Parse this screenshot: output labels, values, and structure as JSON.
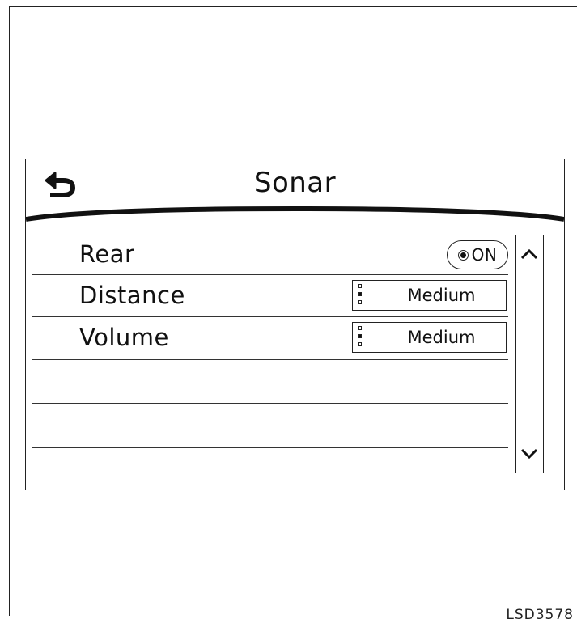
{
  "header": {
    "title": "Sonar",
    "back_icon": "back-arrow-icon"
  },
  "settings": [
    {
      "label": "Rear",
      "control": "toggle",
      "value": "ON",
      "checked": true
    },
    {
      "label": "Distance",
      "control": "selector",
      "value": "Medium",
      "level": "2 of 3",
      "level_fraction": 0.667
    },
    {
      "label": "Volume",
      "control": "selector",
      "value": "Medium",
      "level": "2 of 3",
      "level_fraction": 0.667
    }
  ],
  "scrollbar": {
    "up_icon": "chevron-up-icon",
    "down_icon": "chevron-down-icon"
  },
  "figure_code": "LSD3578"
}
